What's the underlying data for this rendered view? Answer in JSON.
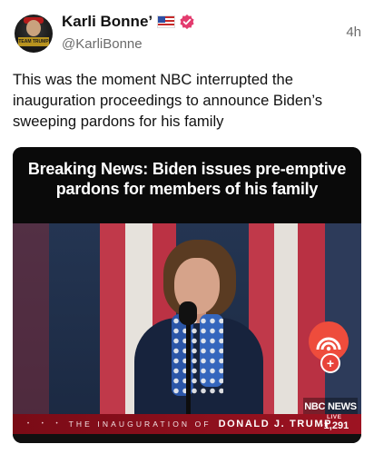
{
  "post": {
    "display_name": "Karli Bonne’",
    "handle": "@KarliBonne",
    "timestamp": "4h",
    "avatar_text": "TEAM TRUMP",
    "text": "This was the moment NBC interrupted the inauguration proceedings to announce Biden’s sweeping pardons for his family"
  },
  "icons": {
    "flag": "us-flag-icon",
    "verified": "verified-badge-icon",
    "verified_color": "#e33b6e"
  },
  "video": {
    "headline": "Breaking News: Biden issues pre-emptive pardons for members of his family",
    "lower_third_stars": "• • •",
    "lower_third_prefix": "THE INAUGURATION OF",
    "lower_third_name": "DONALD J. TRUMP",
    "network_logo": "NBC NEWS",
    "live_label": "LIVE",
    "live_count": "·1,291",
    "bug_plus": "+"
  }
}
